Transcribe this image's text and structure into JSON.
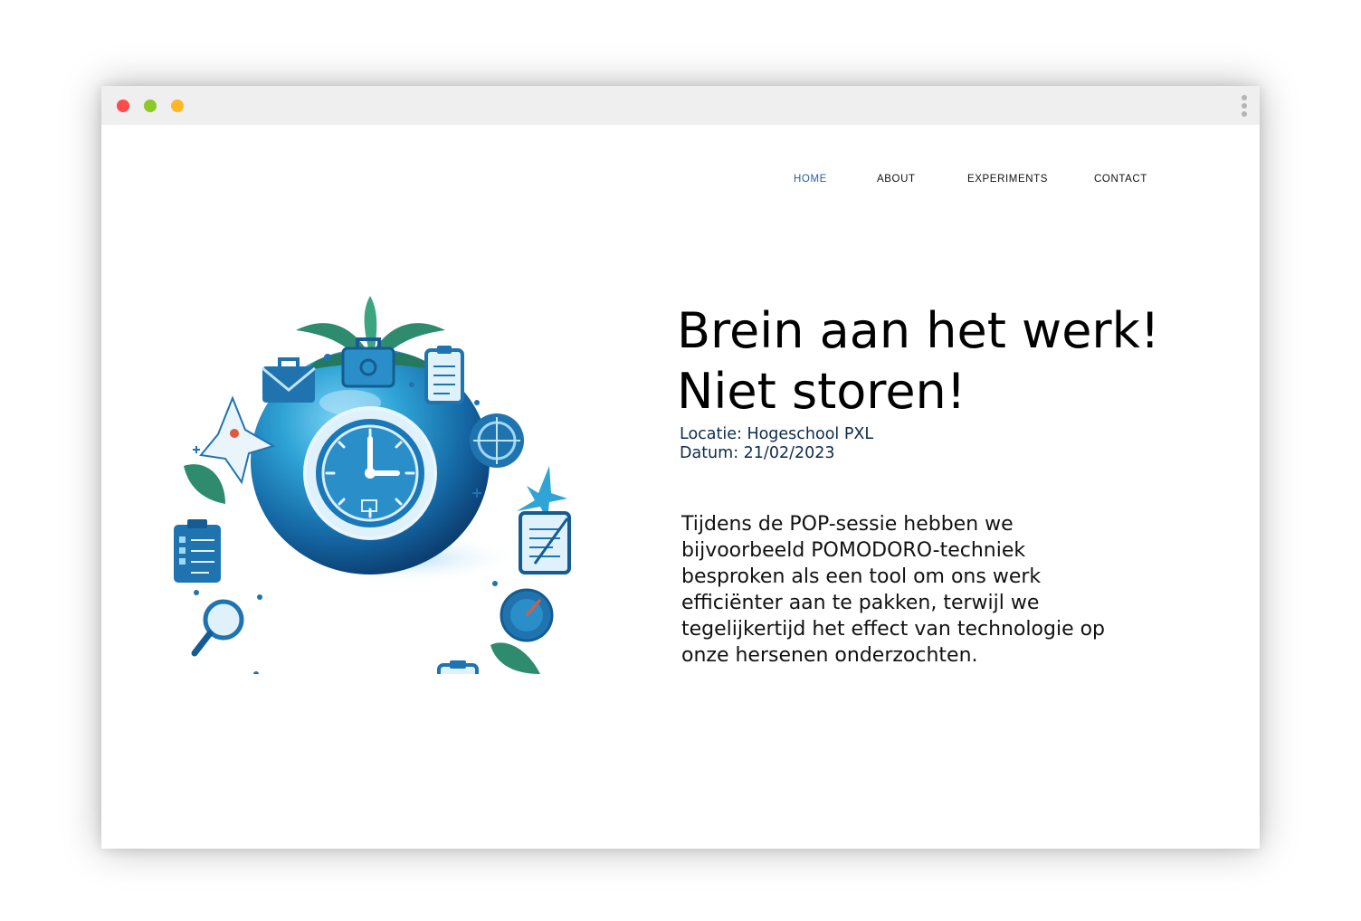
{
  "window": {
    "controls": {
      "close_color": "#ff4b4b",
      "minimize_color": "#8ac926",
      "maximize_color": "#ffb627"
    }
  },
  "nav": {
    "items": [
      {
        "label": "HOME",
        "active": true
      },
      {
        "label": "ABOUT",
        "active": false
      },
      {
        "label": "EXPERIMENTS",
        "active": false
      },
      {
        "label": "CONTACT",
        "active": false
      }
    ],
    "active_color": "#2c5f9e"
  },
  "hero": {
    "title_lines": [
      "Brein aan het werk!",
      "Niet storen!"
    ],
    "location": "Locatie: Hogeschool PXL",
    "date": "Datum: 21/02/2023",
    "description_lines": [
      "Tijdens de POP-sessie hebben we",
      "bijvoorbeeld POMODORO-techniek",
      "besproken als een tool om ons werk",
      "efficiënter aan te pakken, terwijl we",
      "tegelijkertijd het effect van technologie op",
      "onze hersenen onderzochten."
    ],
    "illustration": {
      "icon": "pomodoro-clock-icon",
      "accent": "#1b6fa8",
      "light_accent": "#2fa4d6",
      "leaf": "#2e8b6e"
    }
  }
}
